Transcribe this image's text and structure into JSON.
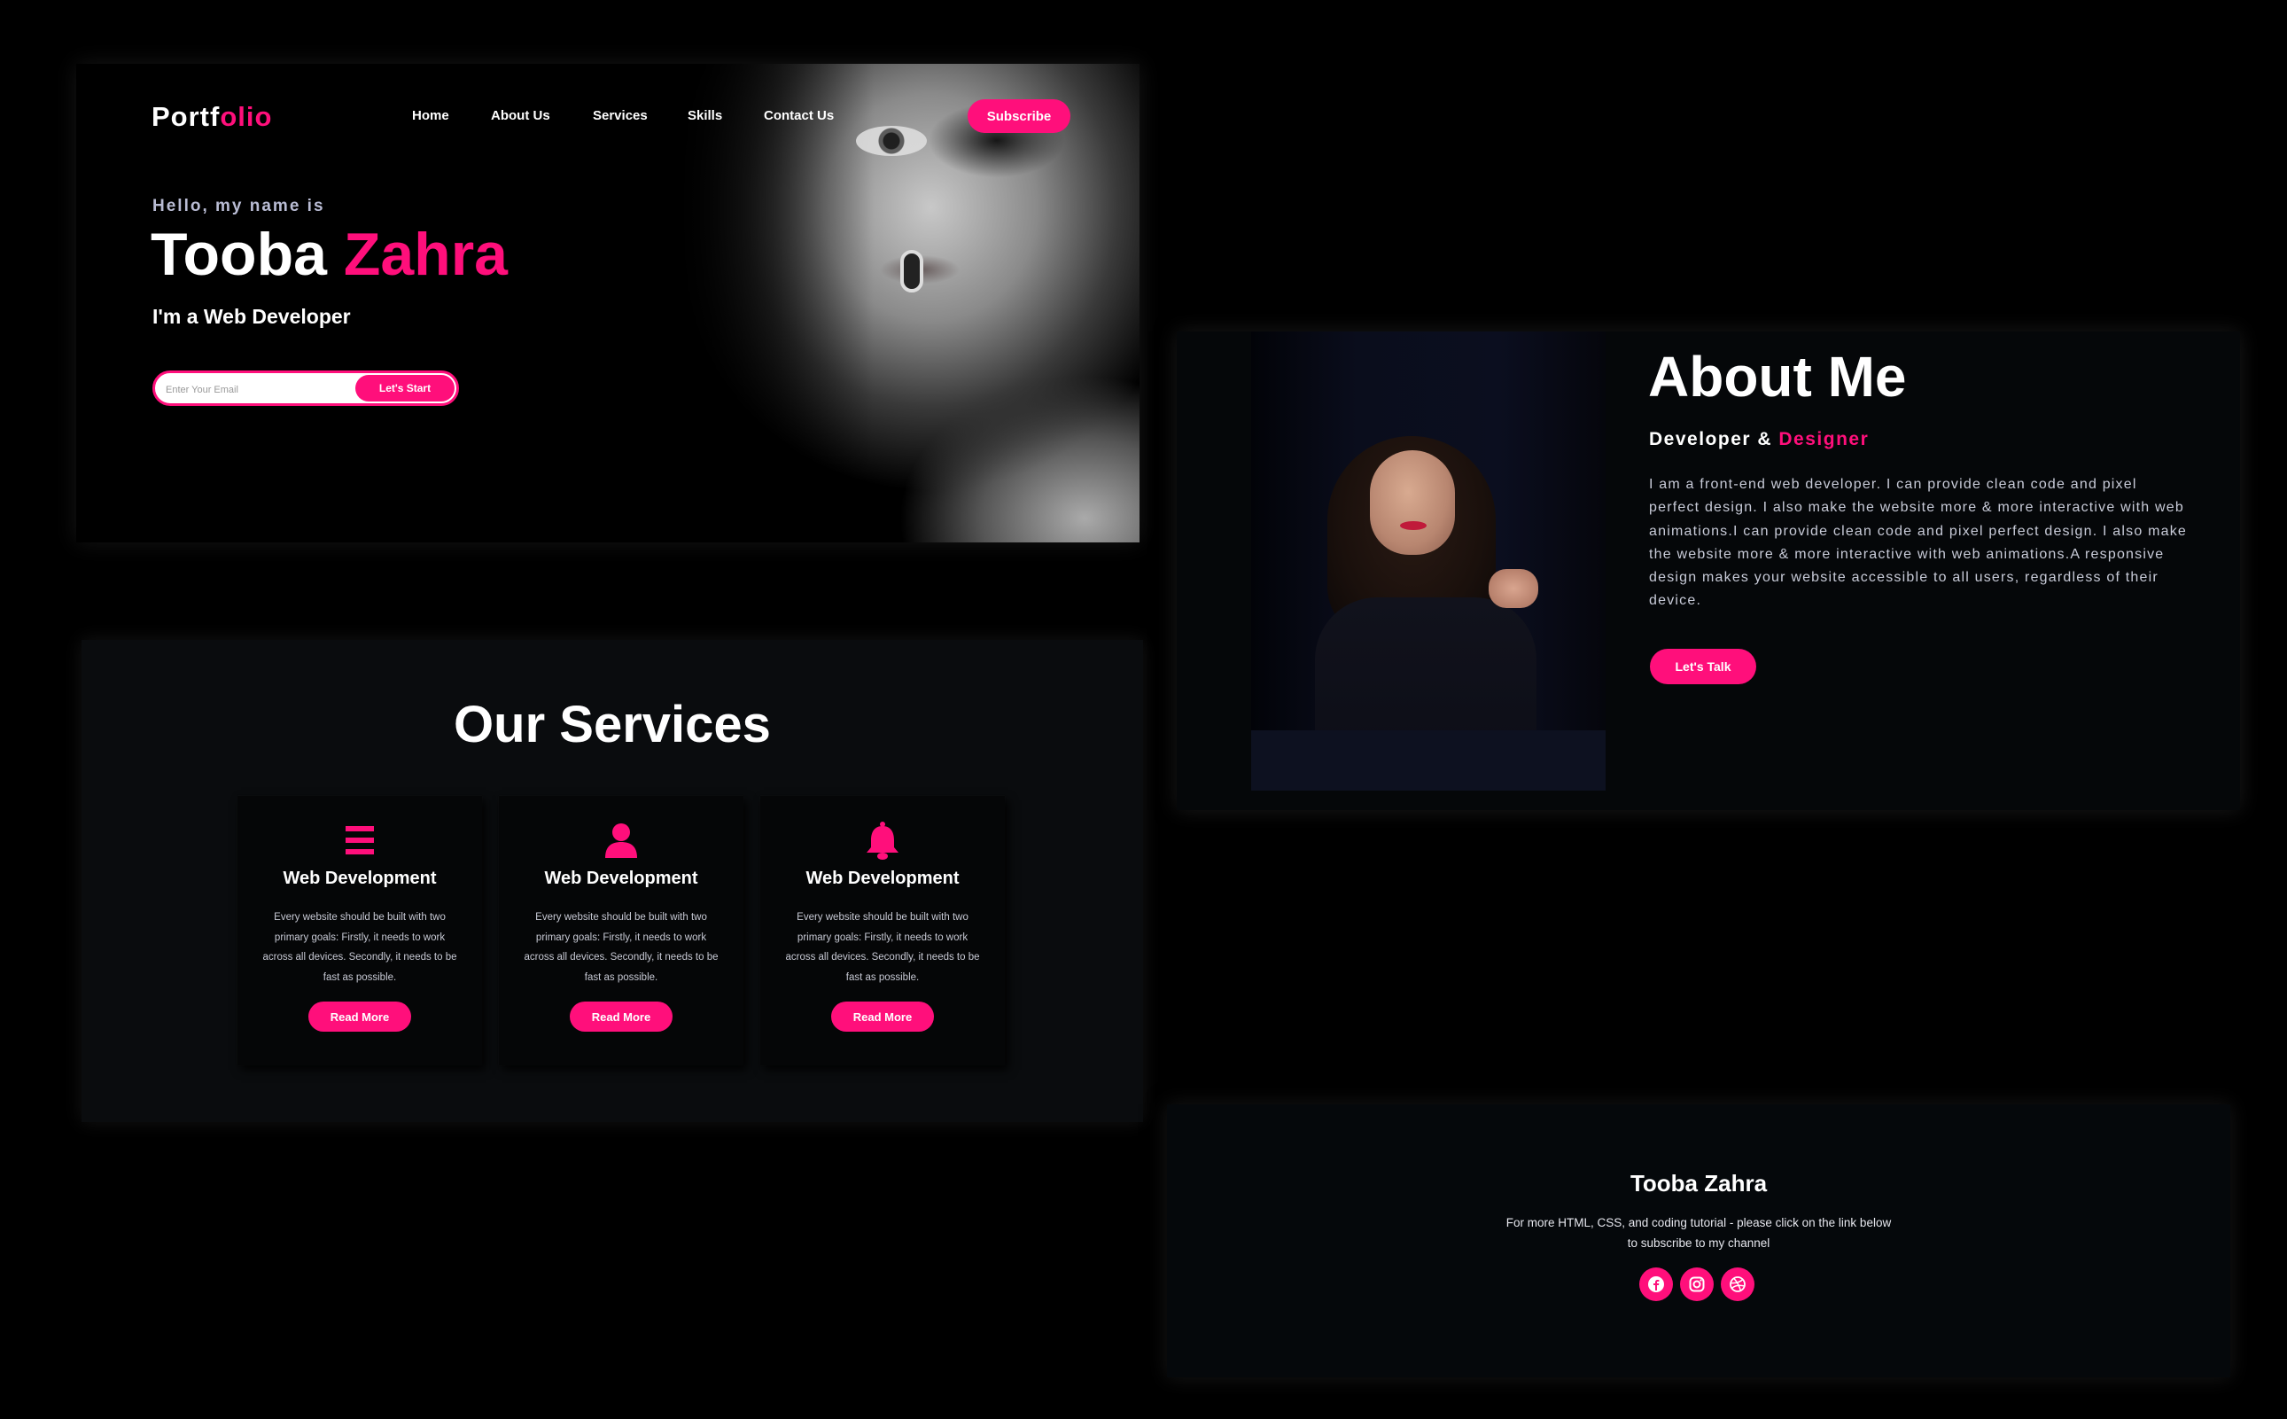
{
  "hero": {
    "logo": {
      "main": "Portf",
      "accent": "olio"
    },
    "nav": [
      "Home",
      "About Us",
      "Services",
      "Skills",
      "Contact Us"
    ],
    "subscribe_label": "Subscribe",
    "greeting": "Hello, my name is",
    "first_name": "Tooba",
    "last_name": "Zahra",
    "role": "I'm a Web Developer",
    "email_placeholder": "Enter Your Email",
    "start_label": "Let's Start"
  },
  "services": {
    "title": "Our Services",
    "cards": [
      {
        "icon": "menu-bars-icon",
        "title": "Web Development",
        "text": "Every website should be built with two primary goals: Firstly, it needs to work across all devices. Secondly, it needs to be fast as possible.",
        "button": "Read More"
      },
      {
        "icon": "user-icon",
        "title": "Web Development",
        "text": "Every website should be built with two primary goals: Firstly, it needs to work across all devices. Secondly, it needs to be fast as possible.",
        "button": "Read More"
      },
      {
        "icon": "bell-icon",
        "title": "Web Development",
        "text": "Every website should be built with two primary goals: Firstly, it needs to work across all devices. Secondly, it needs to be fast as possible.",
        "button": "Read More"
      }
    ]
  },
  "about": {
    "title": "About Me",
    "subtitle_main": "Developer & ",
    "subtitle_accent": "Designer",
    "text": "I am a front-end web developer. I can provide clean code and pixel perfect design. I also make the website more & more interactive with web animations.I can provide clean code and pixel perfect design. I also make the website more & more interactive with web animations.A responsive design makes your website accessible to all users, regardless of their device.",
    "button": "Let's Talk"
  },
  "footer": {
    "name": "Tooba Zahra",
    "text": "For more HTML, CSS, and coding tutorial - please click on the link below to subscribe to my channel",
    "socials": [
      "facebook-icon",
      "instagram-icon",
      "dribbble-icon"
    ]
  },
  "colors": {
    "accent": "#ff0f7b",
    "background": "#000000",
    "panel": "#0a0c0e",
    "muted_text": "#b9bcd4"
  }
}
